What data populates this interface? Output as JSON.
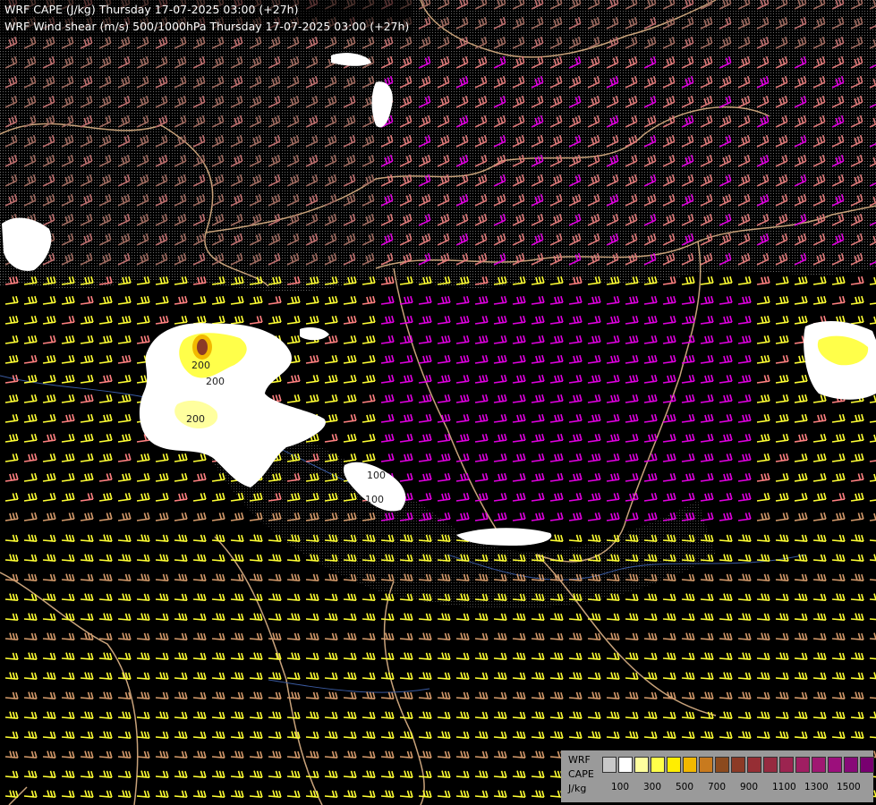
{
  "header": {
    "line1": "WRF CAPE (J/kg) Thursday 17-07-2025 03:00 (+27h)",
    "line2": "WRF Wind shear (m/s) 500/1000hPa Thursday 17-07-2025 03:00 (+27h)"
  },
  "legend": {
    "title1": "WRF",
    "title2": "CAPE",
    "unit": "J/kg",
    "colors": [
      "#c8c8c8",
      "#ffffff",
      "#ffff9e",
      "#ffff4a",
      "#ffee00",
      "#f2b800",
      "#c87a1e",
      "#8c4a1e",
      "#8c3a26",
      "#962e34",
      "#962a40",
      "#9c2450",
      "#a01e62",
      "#a01872",
      "#9c0f7c",
      "#880a78",
      "#780070"
    ],
    "ticks": [
      "100",
      "300",
      "500",
      "700",
      "900",
      "1100",
      "1300",
      "1500"
    ]
  },
  "map": {
    "contour_labels": [
      "200",
      "200",
      "200",
      "100",
      "100"
    ]
  }
}
